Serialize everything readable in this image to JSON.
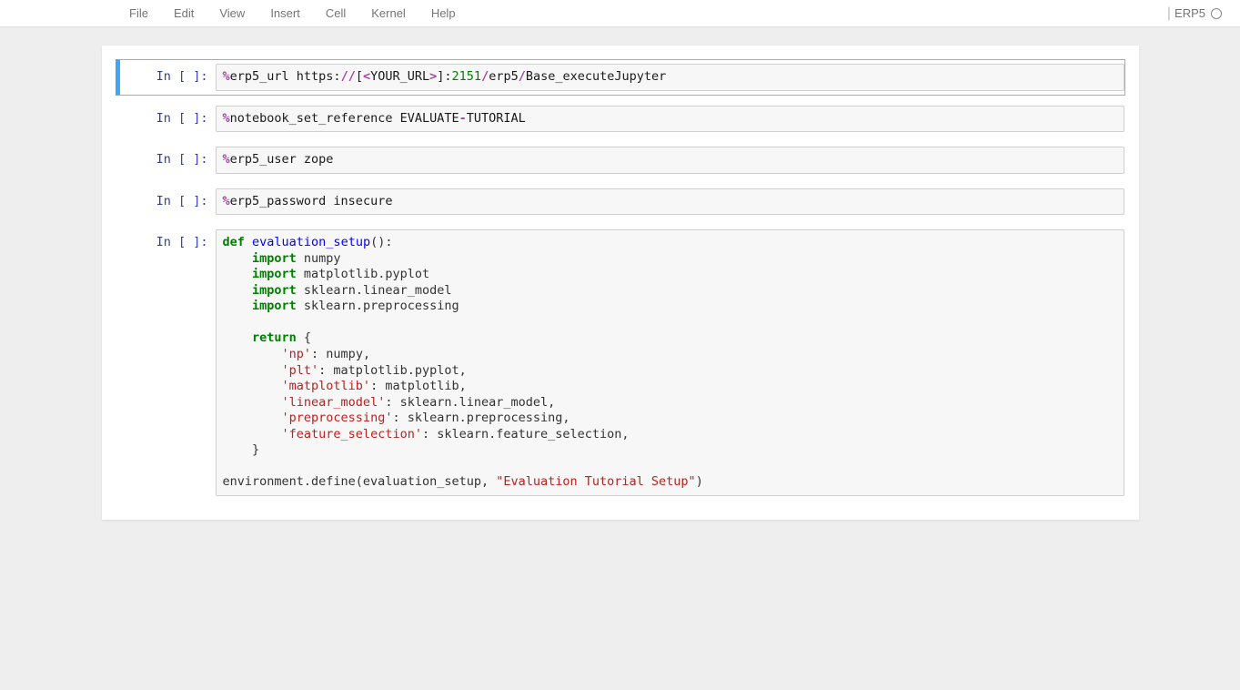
{
  "menu": {
    "file": "File",
    "edit": "Edit",
    "view": "View",
    "insert": "Insert",
    "cell": "Cell",
    "kernel": "Kernel",
    "help": "Help"
  },
  "kernel": {
    "name": "ERP5"
  },
  "prompt_template": "In [ ]:",
  "cells": [
    {
      "selected": true,
      "tokens": [
        {
          "t": "op",
          "v": "%"
        },
        {
          "t": "var2",
          "v": "erp5_url https:"
        },
        {
          "t": "op",
          "v": "//"
        },
        {
          "t": "var2",
          "v": "["
        },
        {
          "t": "op",
          "v": "<"
        },
        {
          "t": "var2",
          "v": "YOUR_URL"
        },
        {
          "t": "op",
          "v": ">"
        },
        {
          "t": "var2",
          "v": "]:"
        },
        {
          "t": "num",
          "v": "2151"
        },
        {
          "t": "op",
          "v": "/"
        },
        {
          "t": "var2",
          "v": "erp5"
        },
        {
          "t": "op",
          "v": "/"
        },
        {
          "t": "var2",
          "v": "Base_executeJupyter"
        }
      ]
    },
    {
      "tokens": [
        {
          "t": "op",
          "v": "%"
        },
        {
          "t": "var2",
          "v": "notebook_set_reference EVALUATE"
        },
        {
          "t": "op",
          "v": "-"
        },
        {
          "t": "var2",
          "v": "TUTORIAL"
        }
      ]
    },
    {
      "tokens": [
        {
          "t": "op",
          "v": "%"
        },
        {
          "t": "var2",
          "v": "erp5_user zope"
        }
      ]
    },
    {
      "tokens": [
        {
          "t": "op",
          "v": "%"
        },
        {
          "t": "var2",
          "v": "erp5_password insecure"
        }
      ]
    },
    {
      "tokens": [
        {
          "t": "kw",
          "v": "def"
        },
        {
          "t": "",
          "v": " "
        },
        {
          "t": "def",
          "v": "evaluation_setup"
        },
        {
          "t": "",
          "v": "():"
        },
        {
          "t": "nl"
        },
        {
          "t": "",
          "v": "    "
        },
        {
          "t": "kw",
          "v": "import"
        },
        {
          "t": "",
          "v": " numpy"
        },
        {
          "t": "nl"
        },
        {
          "t": "",
          "v": "    "
        },
        {
          "t": "kw",
          "v": "import"
        },
        {
          "t": "",
          "v": " matplotlib.pyplot"
        },
        {
          "t": "nl"
        },
        {
          "t": "",
          "v": "    "
        },
        {
          "t": "kw",
          "v": "import"
        },
        {
          "t": "",
          "v": " sklearn.linear_model"
        },
        {
          "t": "nl"
        },
        {
          "t": "",
          "v": "    "
        },
        {
          "t": "kw",
          "v": "import"
        },
        {
          "t": "",
          "v": " sklearn.preprocessing"
        },
        {
          "t": "nl"
        },
        {
          "t": "nl"
        },
        {
          "t": "",
          "v": "    "
        },
        {
          "t": "kw",
          "v": "return"
        },
        {
          "t": "",
          "v": " {"
        },
        {
          "t": "nl"
        },
        {
          "t": "",
          "v": "        "
        },
        {
          "t": "str",
          "v": "'np'"
        },
        {
          "t": "",
          "v": ": numpy,"
        },
        {
          "t": "nl"
        },
        {
          "t": "",
          "v": "        "
        },
        {
          "t": "str",
          "v": "'plt'"
        },
        {
          "t": "",
          "v": ": matplotlib.pyplot,"
        },
        {
          "t": "nl"
        },
        {
          "t": "",
          "v": "        "
        },
        {
          "t": "str",
          "v": "'matplotlib'"
        },
        {
          "t": "",
          "v": ": matplotlib,"
        },
        {
          "t": "nl"
        },
        {
          "t": "",
          "v": "        "
        },
        {
          "t": "str",
          "v": "'linear_model'"
        },
        {
          "t": "",
          "v": ": sklearn.linear_model,"
        },
        {
          "t": "nl"
        },
        {
          "t": "",
          "v": "        "
        },
        {
          "t": "str",
          "v": "'preprocessing'"
        },
        {
          "t": "",
          "v": ": sklearn.preprocessing,"
        },
        {
          "t": "nl"
        },
        {
          "t": "",
          "v": "        "
        },
        {
          "t": "str",
          "v": "'feature_selection'"
        },
        {
          "t": "",
          "v": ": sklearn.feature_selection,"
        },
        {
          "t": "nl"
        },
        {
          "t": "",
          "v": "    }"
        },
        {
          "t": "nl"
        },
        {
          "t": "nl"
        },
        {
          "t": "",
          "v": "environment.define(evaluation_setup, "
        },
        {
          "t": "str",
          "v": "\"Evaluation Tutorial Setup\""
        },
        {
          "t": "",
          "v": ")"
        }
      ]
    }
  ]
}
